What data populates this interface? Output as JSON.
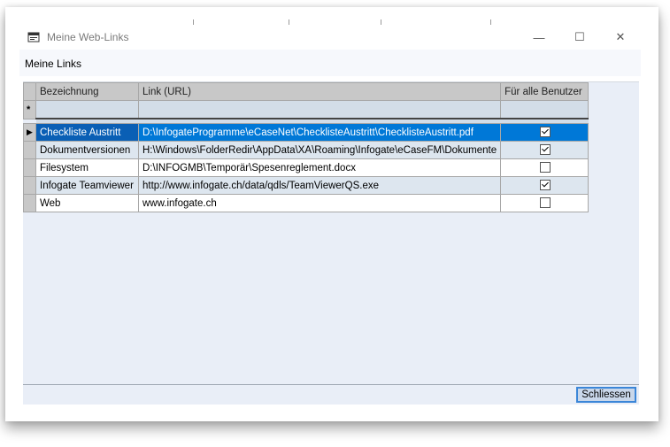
{
  "window": {
    "title": "Meine Web-Links",
    "controls": {
      "minimize": "—",
      "maximize": "☐",
      "close": "✕"
    }
  },
  "menubar": {
    "label": "Meine Links"
  },
  "grid": {
    "columns": [
      "Bezeichnung",
      "Link (URL)",
      "Für alle Benutzer"
    ],
    "new_row_marker": "*",
    "current_row_marker": "▶",
    "rows": [
      {
        "name": "Checkliste Austritt",
        "url": "D:\\InfogateProgramme\\eCaseNet\\ChecklisteAustritt\\ChecklisteAustritt.pdf",
        "all_users": true,
        "selected": true
      },
      {
        "name": "Dokumentversionen",
        "url": "H:\\Windows\\FolderRedir\\AppData\\XA\\Roaming\\Infogate\\eCaseFM\\Dokumente",
        "all_users": true,
        "selected": false
      },
      {
        "name": "Filesystem",
        "url": "D:\\INFOGMB\\Temporär\\Spesenreglement.docx",
        "all_users": false,
        "selected": false
      },
      {
        "name": "Infogate Teamviewer",
        "url": "http://www.infogate.ch/data/qdls/TeamViewerQS.exe",
        "all_users": true,
        "selected": false
      },
      {
        "name": "Web",
        "url": "www.infogate.ch",
        "all_users": false,
        "selected": false
      }
    ]
  },
  "footer": {
    "close_label": "Schliessen"
  },
  "colors": {
    "selection": "#0078d7",
    "client_bg": "#e9eef7",
    "header_bg": "#c8c8c8"
  }
}
